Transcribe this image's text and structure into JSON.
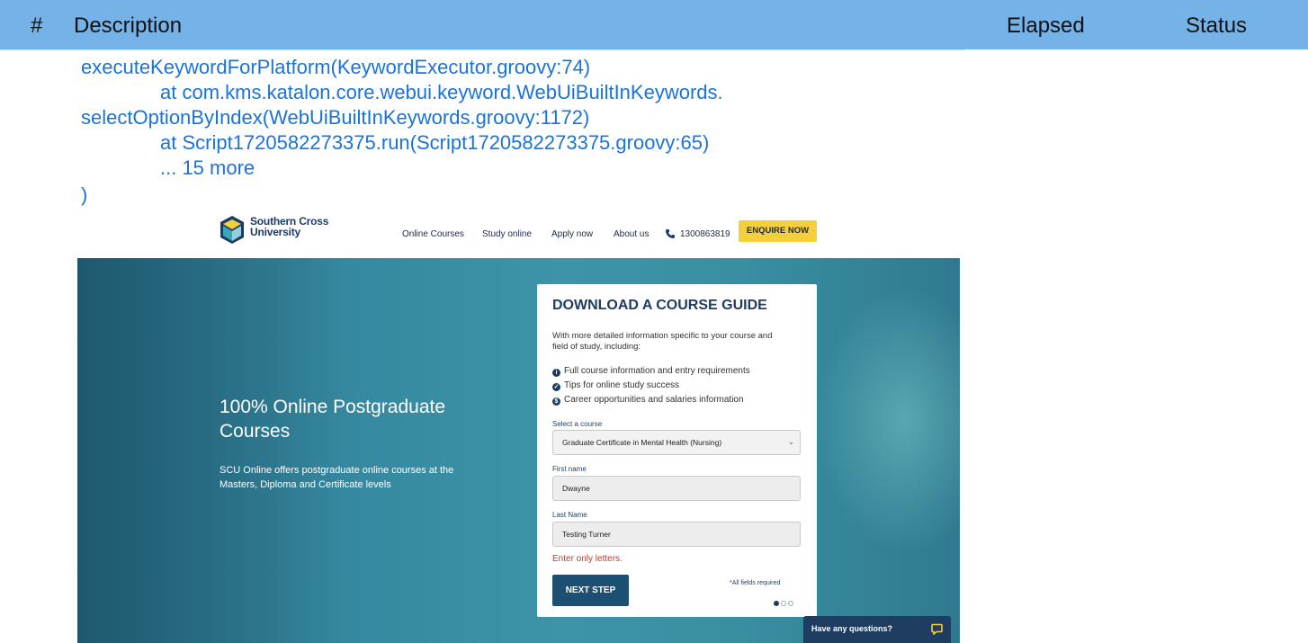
{
  "report": {
    "columns": {
      "number": "#",
      "description": "Description",
      "elapsed": "Elapsed",
      "status": "Status"
    },
    "stack_trace": [
      "executeKeywordForPlatform(KeywordExecutor.groovy:74)",
      "at com.kms.katalon.core.webui.keyword.WebUiBuiltInKeywords.",
      "selectOptionByIndex(WebUiBuiltInKeywords.groovy:1172)",
      "at Script1720582273375.run(Script1720582273375.groovy:65)",
      "... 15 more",
      ")"
    ]
  },
  "site": {
    "logo": {
      "line1": "Southern Cross",
      "line2": "University"
    },
    "nav": [
      "Online Courses",
      "Study online",
      "Apply now",
      "About us"
    ],
    "phone": "1300863819",
    "enquire_label": "ENQUIRE NOW",
    "hero": {
      "title_line1": "100% Online Postgraduate",
      "title_line2": "Courses",
      "subtitle_line1": "SCU Online offers postgraduate online courses at the",
      "subtitle_line2": "Masters, Diploma and Certificate levels"
    },
    "form": {
      "title": "DOWNLOAD A COURSE GUIDE",
      "intro_line1": "With more detailed information specific to your course and",
      "intro_line2": "field of study, including:",
      "bullets": [
        {
          "icon": "i",
          "text": "Full course information and entry requirements"
        },
        {
          "icon": "✓",
          "text": "Tips for online study success"
        },
        {
          "icon": "$",
          "text": "Career opportunities and salaries information"
        }
      ],
      "course_label": "Select a course",
      "course_value": "Graduate Certificate in Mental Health (Nursing)",
      "first_name_label": "First name",
      "first_name_value": "Dwayne",
      "last_name_label": "Last Name",
      "last_name_value": "Testing Turner",
      "error": "Enter only letters.",
      "next_label": "NEXT STEP",
      "required_note": "*All fields required",
      "step": {
        "current": 1,
        "total": 3
      }
    },
    "chat_label": "Have any questions?"
  },
  "colors": {
    "report_header": "#74b2e8",
    "trace_text": "#1a73d9",
    "hero_teal": "#3d94a8",
    "enquire_yellow": "#f5cf3c",
    "navy": "#1d3c5e",
    "error_red": "#c0392b"
  }
}
